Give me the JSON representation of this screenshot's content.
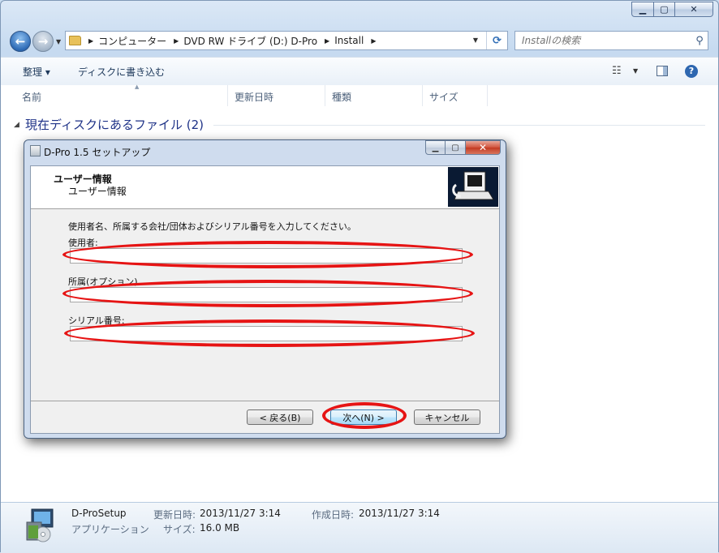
{
  "explorer": {
    "breadcrumb": [
      "コンピューター",
      "DVD RW ドライブ (D:) D-Pro",
      "Install"
    ],
    "search_placeholder": "Installの検索",
    "toolbar": {
      "organize": "整理 ▾",
      "burn": "ディスクに書き込む"
    },
    "columns": [
      "名前",
      "更新日時",
      "種類",
      "サイズ"
    ],
    "group_header": "現在ディスクにあるファイル (2)",
    "details": {
      "file_name": "D-ProSetup",
      "file_type": "アプリケーション",
      "modified_label": "更新日時:",
      "modified_value": "2013/11/27 3:14",
      "created_label": "作成日時:",
      "created_value": "2013/11/27 3:14",
      "size_label": "サイズ:",
      "size_value": "16.0 MB"
    }
  },
  "dialog": {
    "title": "D-Pro 1.5 セットアップ",
    "header_title": "ユーザー情報",
    "header_subtitle": "ユーザー情報",
    "instruction": "使用者名、所属する会社/団体およびシリアル番号を入力してください。",
    "fields": [
      {
        "label": "使用者:",
        "value": ""
      },
      {
        "label": "所属(オプション)",
        "value": ""
      },
      {
        "label": "シリアル番号:",
        "value": ""
      }
    ],
    "buttons": {
      "back": "< 戻る(B)",
      "next": "次へ(N) >",
      "cancel": "キャンセル"
    }
  },
  "colors": {
    "annotation": "#e61414",
    "window_frame": "#c6daf0",
    "link_text": "#1e3287"
  }
}
